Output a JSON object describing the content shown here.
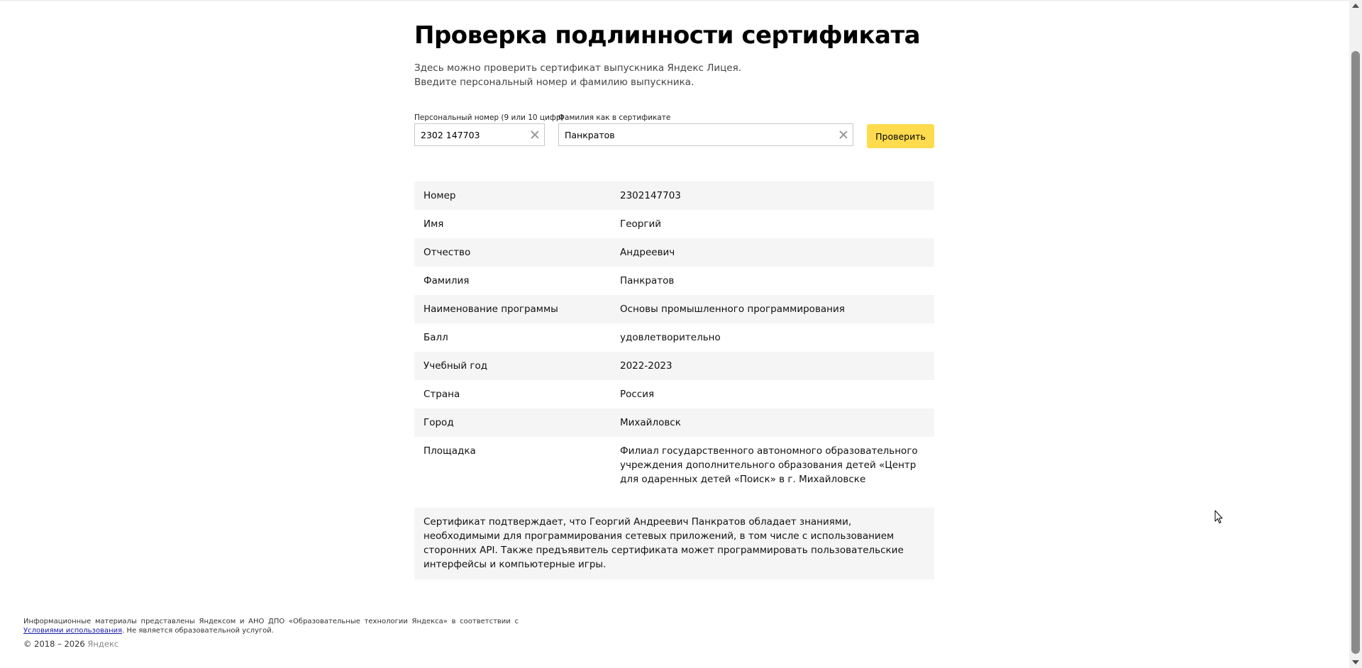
{
  "page": {
    "title": "Проверка подлинности сертификата",
    "intro_line1": "Здесь можно проверить сертификат выпускника Яндекс Лицея.",
    "intro_line2": "Введите персональный номер и фамилию выпускника."
  },
  "form": {
    "number_label": "Персональный номер (9 или 10 цифр)",
    "number_value": "2302 147703",
    "surname_label": "Фамилия как в сертификате",
    "surname_value": "Панкратов",
    "submit_label": "Проверить"
  },
  "certificate": {
    "rows": [
      {
        "key": "Номер",
        "value": "2302147703"
      },
      {
        "key": "Имя",
        "value": "Георгий"
      },
      {
        "key": "Отчество",
        "value": "Андреевич"
      },
      {
        "key": "Фамилия",
        "value": "Панкратов"
      },
      {
        "key": "Наименование программы",
        "value": "Основы промышленного программирования"
      },
      {
        "key": "Балл",
        "value": "удовлетворительно"
      },
      {
        "key": "Учебный год",
        "value": "2022-2023"
      },
      {
        "key": "Страна",
        "value": "Россия"
      },
      {
        "key": "Город",
        "value": "Михайловск"
      },
      {
        "key": "Площадка",
        "value": "Филиал государственного автономного образовательного учреждения дополнительного образования детей «Центр для одаренных детей «Поиск» в г. Михайловске"
      }
    ],
    "description": "Сертификат подтверждает, что Георгий Андреевич Панкратов обладает знаниями, необходимыми для программирования сетевых приложений, в том числе с использованием сторонних API. Также предъявитель сертификата может программировать пользовательские интерфейсы и компьютерные игры."
  },
  "footer": {
    "text_before_link": "Информационные материалы представлены Яндексом и АНО ДПО «Образовательные технологии Яндекса» в соответствии с ",
    "link_text": "Условиями использования",
    "text_after_link": ". Не является образовательной услугой.",
    "copyright": "© 2018 – 2026",
    "brand": "Яндекс"
  },
  "icons": {
    "clear": "close-icon",
    "cursor": "mouse-cursor-icon"
  },
  "colors": {
    "button_bg": "#ffdb4d",
    "row_stripe": "#f5f5f5",
    "link": "#1a1aa6"
  }
}
